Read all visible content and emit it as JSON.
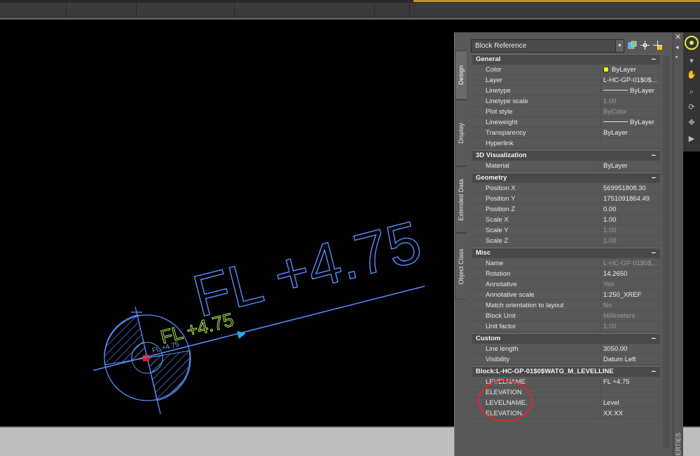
{
  "drawing": {
    "large_label": "FL  +4.75",
    "small_label": "FL  +4.75",
    "tiny_label": "FL +4.75"
  },
  "palette": {
    "tabs": [
      "Design",
      "Display",
      "Extended Data",
      "Object Class"
    ],
    "object_type": "Block Reference",
    "side_title": "PERTIES",
    "colors": {
      "byLayer_swatch": "#ffff00",
      "drawing_lines": "#5b8dff",
      "annotation_circle": "#e3262d"
    },
    "sections": [
      {
        "title": "General",
        "toggle": "−",
        "rows": [
          {
            "label": "Color",
            "value": "ByLayer",
            "swatch": "color"
          },
          {
            "label": "Layer",
            "value": "L-HC-GP-01$0$..."
          },
          {
            "label": "Linetype",
            "value": "ByLayer",
            "swatch": "line"
          },
          {
            "label": "Linetype scale",
            "value": "1.00",
            "dim": true
          },
          {
            "label": "Plot style",
            "value": "ByColor",
            "dim": true
          },
          {
            "label": "Lineweight",
            "value": "ByLayer",
            "swatch": "line"
          },
          {
            "label": "Transparency",
            "value": "ByLayer"
          },
          {
            "label": "Hyperlink",
            "value": ""
          }
        ]
      },
      {
        "title": "3D Visualization",
        "toggle": "−",
        "rows": [
          {
            "label": "Material",
            "value": "ByLayer"
          }
        ]
      },
      {
        "title": "Geometry",
        "toggle": "−",
        "rows": [
          {
            "label": "Position X",
            "value": "569951808.30"
          },
          {
            "label": "Position Y",
            "value": "1751091864.49"
          },
          {
            "label": "Position Z",
            "value": "0.00"
          },
          {
            "label": "Scale X",
            "value": "1.00"
          },
          {
            "label": "Scale Y",
            "value": "1.00",
            "dim": true
          },
          {
            "label": "Scale Z",
            "value": "1.00",
            "dim": true
          }
        ]
      },
      {
        "title": "Misc",
        "toggle": "−",
        "rows": [
          {
            "label": "Name",
            "value": "L-HC-GP-01$0$...",
            "dim": true
          },
          {
            "label": "Rotation",
            "value": "14.2650"
          },
          {
            "label": "Annotative",
            "value": "Yes",
            "dim": true
          },
          {
            "label": "Annotative scale",
            "value": "1:250_XREF"
          },
          {
            "label": "Match orientation to layout",
            "value": "No",
            "dim": true
          },
          {
            "label": "Block Unit",
            "value": "Millimeters",
            "dim": true
          },
          {
            "label": "Unit factor",
            "value": "1.00",
            "dim": true
          }
        ]
      },
      {
        "title": "Custom",
        "toggle": "−",
        "rows": [
          {
            "label": "Line length",
            "value": "3050.00"
          },
          {
            "label": "Visibility",
            "value": "Datum Left"
          }
        ]
      },
      {
        "title": "Block:L-HC-GP-01$0$WATG_M_LEVELLINE",
        "toggle": "−",
        "rows": [
          {
            "label": "LEVELNAME",
            "value": "FL +4.75"
          },
          {
            "label": "ELEVATION",
            "value": ""
          },
          {
            "label": "LEVELNAME.",
            "value": "Level"
          },
          {
            "label": "ELEVATION.",
            "value": "XX.XX"
          }
        ]
      }
    ]
  }
}
